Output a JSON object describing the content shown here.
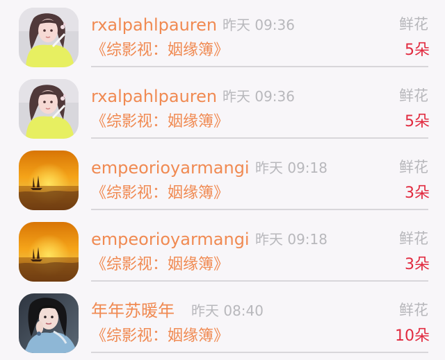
{
  "colors": {
    "background": "#f8f6f9",
    "username": "#f08a52",
    "muted": "#b8b8bc",
    "count": "#e12a3f",
    "divider": "#d8d6da"
  },
  "rows": [
    {
      "avatar_icon": "woman-yellow-top-avatar-icon",
      "username": "rxalpahlpauren",
      "time": "昨天 09:36",
      "gift_label": "鲜花",
      "book": "《综影视：姻缘簿》",
      "count": "5朵"
    },
    {
      "avatar_icon": "woman-yellow-top-avatar-icon",
      "username": "rxalpahlpauren",
      "time": "昨天 09:36",
      "gift_label": "鲜花",
      "book": "《综影视：姻缘簿》",
      "count": "5朵"
    },
    {
      "avatar_icon": "sunset-sailboat-avatar-icon",
      "username": "empeorioyarmangi",
      "time": "昨天 09:18",
      "gift_label": "鲜花",
      "book": "《综影视：姻缘簿》",
      "count": "3朵"
    },
    {
      "avatar_icon": "sunset-sailboat-avatar-icon",
      "username": "empeorioyarmangi",
      "time": "昨天 09:18",
      "gift_label": "鲜花",
      "book": "《综影视：姻缘簿》",
      "count": "3朵"
    },
    {
      "avatar_icon": "woman-dark-hair-avatar-icon",
      "username": "年年苏暖年",
      "time": "昨天 08:40",
      "gift_label": "鲜花",
      "book": "《综影视：姻缘簿》",
      "count": "10朵"
    }
  ]
}
